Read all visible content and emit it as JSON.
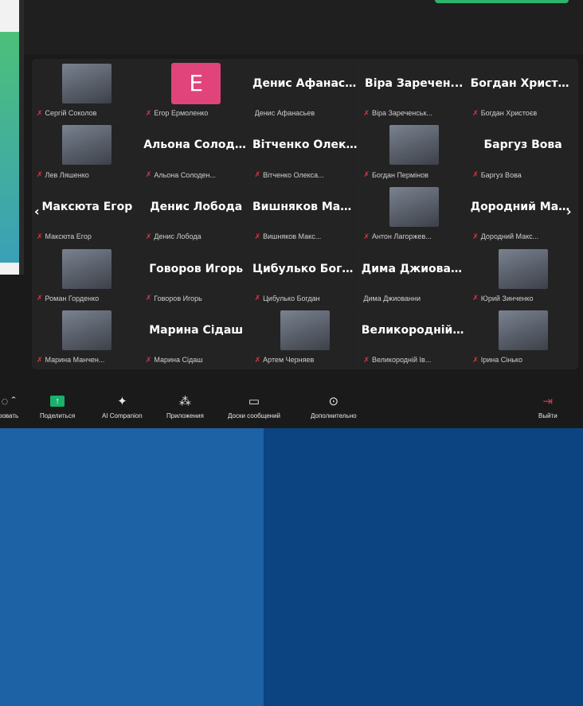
{
  "participants": [
    {
      "label": "Сергій Соколов",
      "big": "",
      "avatar": "photo",
      "muted": true
    },
    {
      "label": "Егор Ермоленко",
      "big": "",
      "avatar": "letter",
      "letter": "E",
      "muted": true
    },
    {
      "label": "Денис Афанасьев",
      "big": "Денис Афанась...",
      "avatar": "none",
      "muted": false
    },
    {
      "label": "Віра Зареченськ...",
      "big": "Віра Заречен...",
      "avatar": "none",
      "muted": true
    },
    {
      "label": "Богдан Христоєв",
      "big": "Богдан Христоєв",
      "avatar": "none",
      "muted": true
    },
    {
      "label": "Лев Ляшенко",
      "big": "",
      "avatar": "photo",
      "muted": true
    },
    {
      "label": "Альона Солоден...",
      "big": "Альона Солоде...",
      "avatar": "none",
      "muted": true
    },
    {
      "label": "Вітченко Олекса...",
      "big": "Вітченко Олекс...",
      "avatar": "none",
      "muted": true
    },
    {
      "label": "Богдан Пермінов",
      "big": "",
      "avatar": "photo",
      "muted": true
    },
    {
      "label": "Баргуз Вова",
      "big": "Баргуз Вова",
      "avatar": "none",
      "muted": true
    },
    {
      "label": "Максюта Егор",
      "big": "Максюта Егор",
      "avatar": "none",
      "muted": true
    },
    {
      "label": "Денис Лобода",
      "big": "Денис Лобода",
      "avatar": "none",
      "muted": true
    },
    {
      "label": "Вишняков Макс...",
      "big": "Вишняков Мак...",
      "avatar": "none",
      "muted": true
    },
    {
      "label": "Антон Лагоржев...",
      "big": "",
      "avatar": "photo",
      "muted": true
    },
    {
      "label": "Дородний Макс...",
      "big": "Дородний Мак...",
      "avatar": "none",
      "muted": true
    },
    {
      "label": "Роман Горденко",
      "big": "",
      "avatar": "photo",
      "muted": true
    },
    {
      "label": "Говоров Игорь",
      "big": "Говоров Игорь",
      "avatar": "none",
      "muted": true
    },
    {
      "label": "Цибулько Богдан",
      "big": "Цибулько Богд...",
      "avatar": "none",
      "muted": true
    },
    {
      "label": "Дима Джиованни",
      "big": "Дима Джиован...",
      "avatar": "none",
      "muted": false
    },
    {
      "label": "Юрий Зинченко",
      "big": "",
      "avatar": "photo",
      "muted": true
    },
    {
      "label": "Марина Манчен...",
      "big": "",
      "avatar": "photo",
      "muted": true
    },
    {
      "label": "Марина Сідаш",
      "big": "Марина Сідаш",
      "avatar": "none",
      "muted": true
    },
    {
      "label": "Артем Черняев",
      "big": "",
      "avatar": "photo",
      "muted": true
    },
    {
      "label": "Великородній Ів...",
      "big": "Великородній І...",
      "avatar": "none",
      "muted": true
    },
    {
      "label": "Ірина Сінько",
      "big": "",
      "avatar": "photo",
      "muted": true
    }
  ],
  "toolbar": {
    "record_partial": "ровать",
    "share": "Поделиться",
    "ai": "AI Companion",
    "apps": "Приложения",
    "boards": "Доски сообщений",
    "more": "Дополнительно",
    "leave": "Выйти"
  },
  "nav": {
    "prev": "‹",
    "next": "›"
  },
  "colors": {
    "accent": "#18b06a",
    "letter_avatar": "#e0447a",
    "muted_icon": "#e0344a",
    "bg_left": "#1d62a4",
    "bg_right": "#0b4481"
  }
}
